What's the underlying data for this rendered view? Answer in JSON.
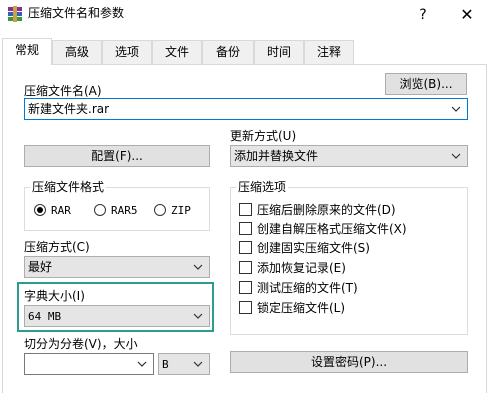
{
  "window": {
    "title": "压缩文件名和参数",
    "help_glyph": "?",
    "close_glyph": "✕",
    "icon": "winrar-app-icon"
  },
  "tabs": [
    {
      "label": "常规",
      "active": true
    },
    {
      "label": "高级"
    },
    {
      "label": "选项"
    },
    {
      "label": "文件"
    },
    {
      "label": "备份"
    },
    {
      "label": "时间"
    },
    {
      "label": "注释"
    }
  ],
  "archive_name": {
    "label": "压缩文件名(A)",
    "value": "新建文件夹.rar",
    "browse_label": "浏览(B)..."
  },
  "update_mode": {
    "label": "更新方式(U)",
    "value": "添加并替换文件"
  },
  "profiles_button": "配置(F)...",
  "archive_format": {
    "title": "压缩文件格式",
    "options": [
      "RAR",
      "RAR5",
      "ZIP"
    ],
    "selected": "RAR"
  },
  "compression_method": {
    "label": "压缩方式(C)",
    "value": "最好"
  },
  "dictionary_size": {
    "label": "字典大小(I)",
    "value": "64 MB"
  },
  "split_volumes": {
    "label": "切分为分卷(V)，大小",
    "value": "",
    "unit": "B"
  },
  "archive_options": {
    "title": "压缩选项",
    "items": [
      {
        "label": "压缩后删除原来的文件(D)",
        "checked": false
      },
      {
        "label": "创建自解压格式压缩文件(X)",
        "checked": false
      },
      {
        "label": "创建固实压缩文件(S)",
        "checked": false
      },
      {
        "label": "添加恢复记录(E)",
        "checked": false
      },
      {
        "label": "测试压缩的文件(T)",
        "checked": false
      },
      {
        "label": "锁定压缩文件(L)",
        "checked": false
      }
    ]
  },
  "set_password_button": "设置密码(P)...",
  "colors": {
    "highlight": "#2a9d8f",
    "combo_gray": "#e5e5e5",
    "button_face": "#e1e1e1"
  }
}
